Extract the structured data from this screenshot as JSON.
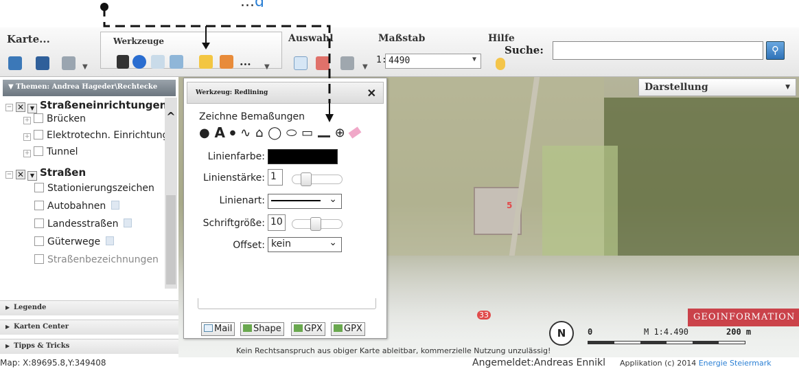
{
  "header_partial": {
    "dark": "...",
    "blue": "g"
  },
  "toolbar": {
    "karte_label": "Karte...",
    "werkzeuge_label": "Werkzeuge",
    "auswahl_label": "Auswahl",
    "massstab_label": "Maßstab",
    "hilfe_label": "Hilfe",
    "scale_prefix": "1:",
    "scale_value": "4490",
    "search_label": "Suche:",
    "search_value": "",
    "more_label": "..."
  },
  "sidebar": {
    "header": "▼ Themen: Andrea Hageder\\Rechtecke",
    "tree": [
      {
        "label": "Straßeneinrichtungen",
        "kind": "group"
      },
      {
        "label": "Brücken",
        "kind": "item"
      },
      {
        "label": "Elektrotechn. Einrichtungen",
        "kind": "item"
      },
      {
        "label": "Tunnel",
        "kind": "item"
      },
      {
        "label": "Straßen",
        "kind": "group"
      },
      {
        "label": "Stationierungszeichen",
        "kind": "leaf"
      },
      {
        "label": "Autobahnen",
        "kind": "leaf"
      },
      {
        "label": "Landesstraßen",
        "kind": "leaf"
      },
      {
        "label": "Güterwege",
        "kind": "leaf"
      },
      {
        "label": "Straßenbezeichnungen",
        "kind": "leaf"
      }
    ],
    "sections": [
      "Legende",
      "Karten Center",
      "Tipps & Tricks"
    ]
  },
  "map": {
    "darstellung_label": "Darstellung",
    "badge": "GEOINFORMATION",
    "scale_text": "M 1:4.490",
    "scale_zero": "0",
    "scale_distance": "200 m",
    "north_label": "N",
    "footer_note": "Kein Rechtsanspruch aus obiger Karte ableitbar, kommerzielle Nutzung unzulässig!",
    "marker_labels": [
      "5",
      "33"
    ]
  },
  "dialog": {
    "title": "Werkzeug: Redlining",
    "subtitle": "Zeichne Bemaßungen",
    "labels": {
      "linienfarbe": "Linienfarbe:",
      "linienstaerke": "Linienstärke:",
      "linienart": "Linienart:",
      "schriftgroesse": "Schriftgröße:",
      "offset": "Offset:"
    },
    "values": {
      "linienstaerke": "1",
      "schriftgroesse": "10",
      "offset": "kein"
    },
    "linienstaerke_level": 0.2,
    "schriftgroesse_level": 0.45,
    "line_color": "#000000",
    "export_buttons": [
      "Mail",
      "Shape",
      "GPX",
      "GPX"
    ]
  },
  "status": {
    "coordinates": "Map: X:89695.8,Y:349408",
    "logged_in": "Angemeldet:Andreas Ennikl",
    "app_info": "Applikation (c) 2014",
    "app_link": "Energie Steiermark"
  }
}
